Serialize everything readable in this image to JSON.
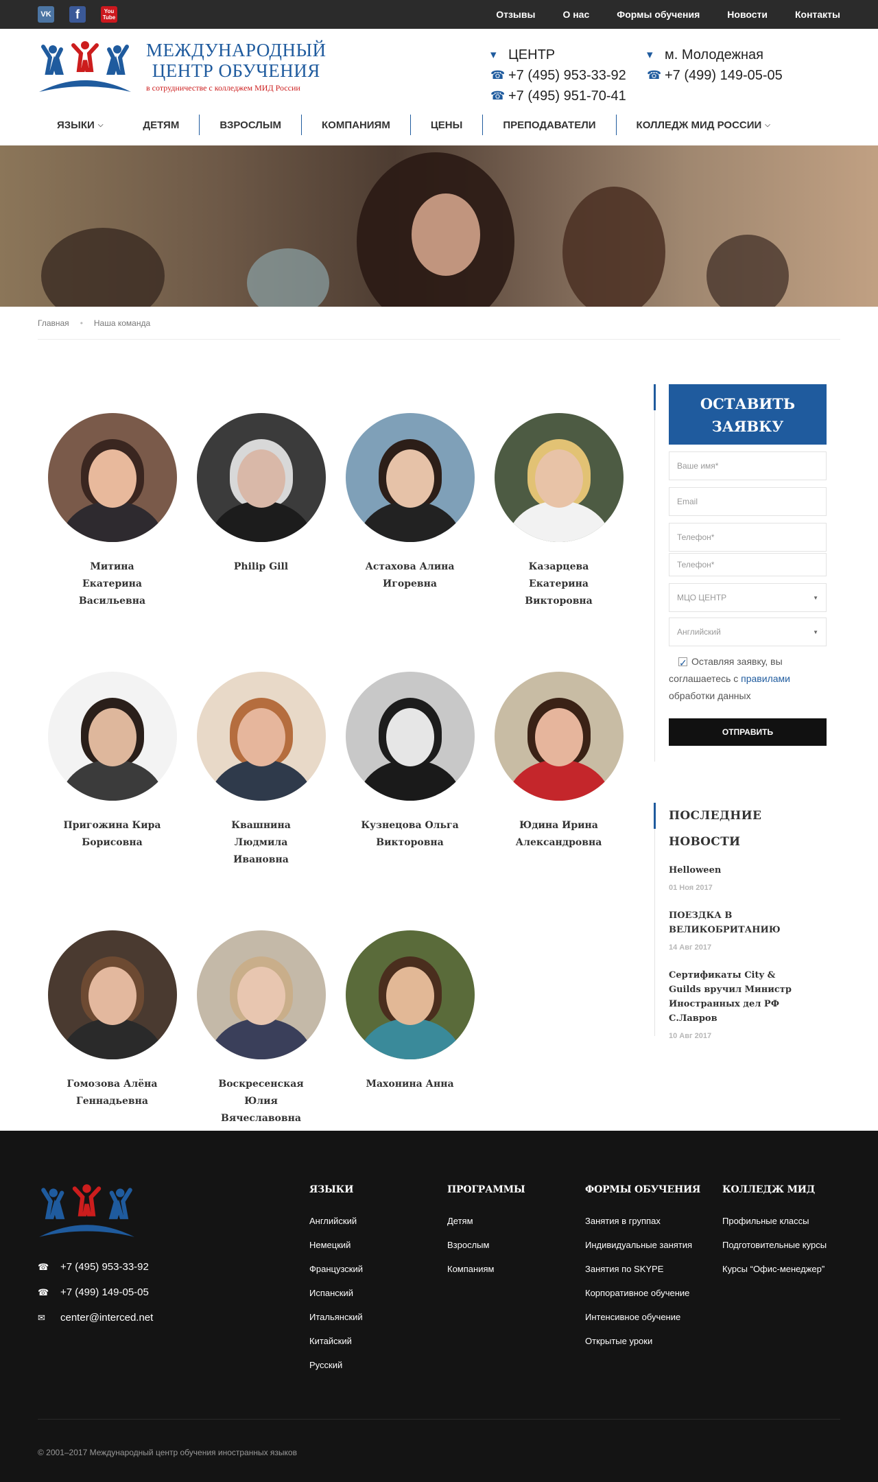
{
  "topbar": {
    "social": [
      {
        "icon": "vk-icon",
        "label": "VK"
      },
      {
        "icon": "facebook-icon",
        "label": "f"
      },
      {
        "icon": "youtube-icon",
        "label": "You Tube"
      }
    ],
    "nav": [
      "Отзывы",
      "О нас",
      "Формы обучения",
      "Новости",
      "Контакты"
    ]
  },
  "logo": {
    "line1": "МЕЖДУНАРОДНЫЙ",
    "line2": "ЦЕНТР ОБУЧЕНИЯ",
    "subtitle": "в сотрудничестве с колледжем МИД России"
  },
  "contacts": {
    "center_label": "ЦЕНТР",
    "molod_label": "м. Молодежная",
    "center_phone1": "+7 (495) 953-33-92",
    "molod_phone": "+7 (499) 149-05-05",
    "center_phone2": "+7 (495) 951-70-41"
  },
  "mainnav": [
    {
      "label": "ЯЗЫКИ",
      "dropdown": true
    },
    {
      "label": "ДЕТЯМ",
      "dropdown": false
    },
    {
      "label": "ВЗРОСЛЫМ",
      "dropdown": false
    },
    {
      "label": "КОМПАНИЯМ",
      "dropdown": false
    },
    {
      "label": "ЦЕНЫ",
      "dropdown": false
    },
    {
      "label": "ПРЕПОДАВАТЕЛИ",
      "dropdown": false
    },
    {
      "label": "КОЛЛЕДЖ МИД РОССИИ",
      "dropdown": true
    }
  ],
  "breadcrumb": {
    "home": "Главная",
    "current": "Наша команда"
  },
  "team": [
    {
      "name": "Митина Екатерина Васильевна",
      "bg": "#7a5a4a",
      "skin": "#e8b99c",
      "hair": "#3a2620",
      "cloth": "#2e2a2f"
    },
    {
      "name": "Philip Gill",
      "bg": "#3b3b3b",
      "skin": "#d9b8a8",
      "hair": "#d8d8d8",
      "cloth": "#1c1c1c"
    },
    {
      "name": "Астахова Алина Игоревна",
      "bg": "#7fa0b8",
      "skin": "#e6c2a8",
      "hair": "#2c1e18",
      "cloth": "#222"
    },
    {
      "name": "Казарцева Екатерина Викторовна",
      "bg": "#4d5b43",
      "skin": "#e8c3a7",
      "hair": "#e2c274",
      "cloth": "#f2f2f2"
    },
    {
      "name": "Пригожина Кира Борисовна",
      "bg": "#f3f3f3",
      "skin": "#deb79c",
      "hair": "#2a1f1a",
      "cloth": "#3b3b3b"
    },
    {
      "name": "Квашнина Людмила Ивановна",
      "bg": "#e8d9c8",
      "skin": "#e6b69c",
      "hair": "#b56d3e",
      "cloth": "#2f3a4b"
    },
    {
      "name": "Кузнецова Ольга Викторовна",
      "bg": "#c8c8c8",
      "skin": "#e6e6e6",
      "hair": "#1c1c1c",
      "cloth": "#1a1a1a"
    },
    {
      "name": "Юдина Ирина Александровна",
      "bg": "#c8bca4",
      "skin": "#e6b59c",
      "hair": "#3a2216",
      "cloth": "#c4262b"
    },
    {
      "name": "Гомозова Алёна Геннадьевна",
      "bg": "#4a3a30",
      "skin": "#e3b89e",
      "hair": "#6d4a32",
      "cloth": "#2a2a2a"
    },
    {
      "name": "Воскресенская Юлия Вячеславовна",
      "bg": "#c4b9a8",
      "skin": "#e8c6b0",
      "hair": "#c9ae8a",
      "cloth": "#3a3f5a"
    },
    {
      "name": "Махонина Анна",
      "bg": "#5a6b3a",
      "skin": "#e2b896",
      "hair": "#4a2e1e",
      "cloth": "#3a8a9a"
    }
  ],
  "form": {
    "title_line1": "ОСТАВИТЬ",
    "title_line2": "ЗАЯВКУ",
    "name_placeholder": "Ваше имя*",
    "email_placeholder": "Email",
    "phone_placeholder": "Телефон*",
    "phone2_placeholder": "Телефон*",
    "center_select": "МЦО ЦЕНТР",
    "language_select": "Английский",
    "consent_before": "Оставляя заявку, вы соглашаетесь с ",
    "consent_link": "правилами",
    "consent_after": " обработки данных",
    "submit": "ОТПРАВИТЬ"
  },
  "news": {
    "title": "ПОСЛЕДНИЕ НОВОСТИ",
    "items": [
      {
        "title": "Helloween",
        "date": "01 Ноя 2017"
      },
      {
        "title": "ПОЕЗДКА В ВЕЛИКОБРИТАНИЮ",
        "date": "14 Авг 2017"
      },
      {
        "title": "Сертификаты City & Guilds вручил Министр Иностранных дел РФ С.Лавров",
        "date": "10 Авг 2017"
      }
    ]
  },
  "footer": {
    "phone1": "+7 (495) 953-33-92",
    "phone2": "+7 (499) 149-05-05",
    "email": "center@interced.net",
    "columns": [
      {
        "title": "ЯЗЫКИ",
        "links": [
          "Английский",
          "Немецкий",
          "Французский",
          "Испанский",
          "Итальянский",
          "Китайский",
          "Русский"
        ]
      },
      {
        "title": "ПРОГРАММЫ",
        "links": [
          "Детям",
          "Взрослым",
          "Компаниям"
        ]
      },
      {
        "title": "ФОРМЫ ОБУЧЕНИЯ",
        "links": [
          "Занятия в группах",
          "Индивидуальные занятия",
          "Занятия по SKYPE",
          "Корпоративное обучение",
          "Интенсивное обучение",
          "Открытые уроки"
        ]
      },
      {
        "title": "КОЛЛЕДЖ МИД",
        "links": [
          "Профильные классы",
          "Подготовительные курсы",
          "Курсы “Офис-менеджер”"
        ]
      }
    ],
    "copyright": "© 2001–2017 Международный центр обучения иностранных языков"
  },
  "colors": {
    "brand_blue": "#1f5b9e",
    "brand_red": "#cc1d1d",
    "topbar": "#2b2b2b",
    "footer": "#141414"
  }
}
